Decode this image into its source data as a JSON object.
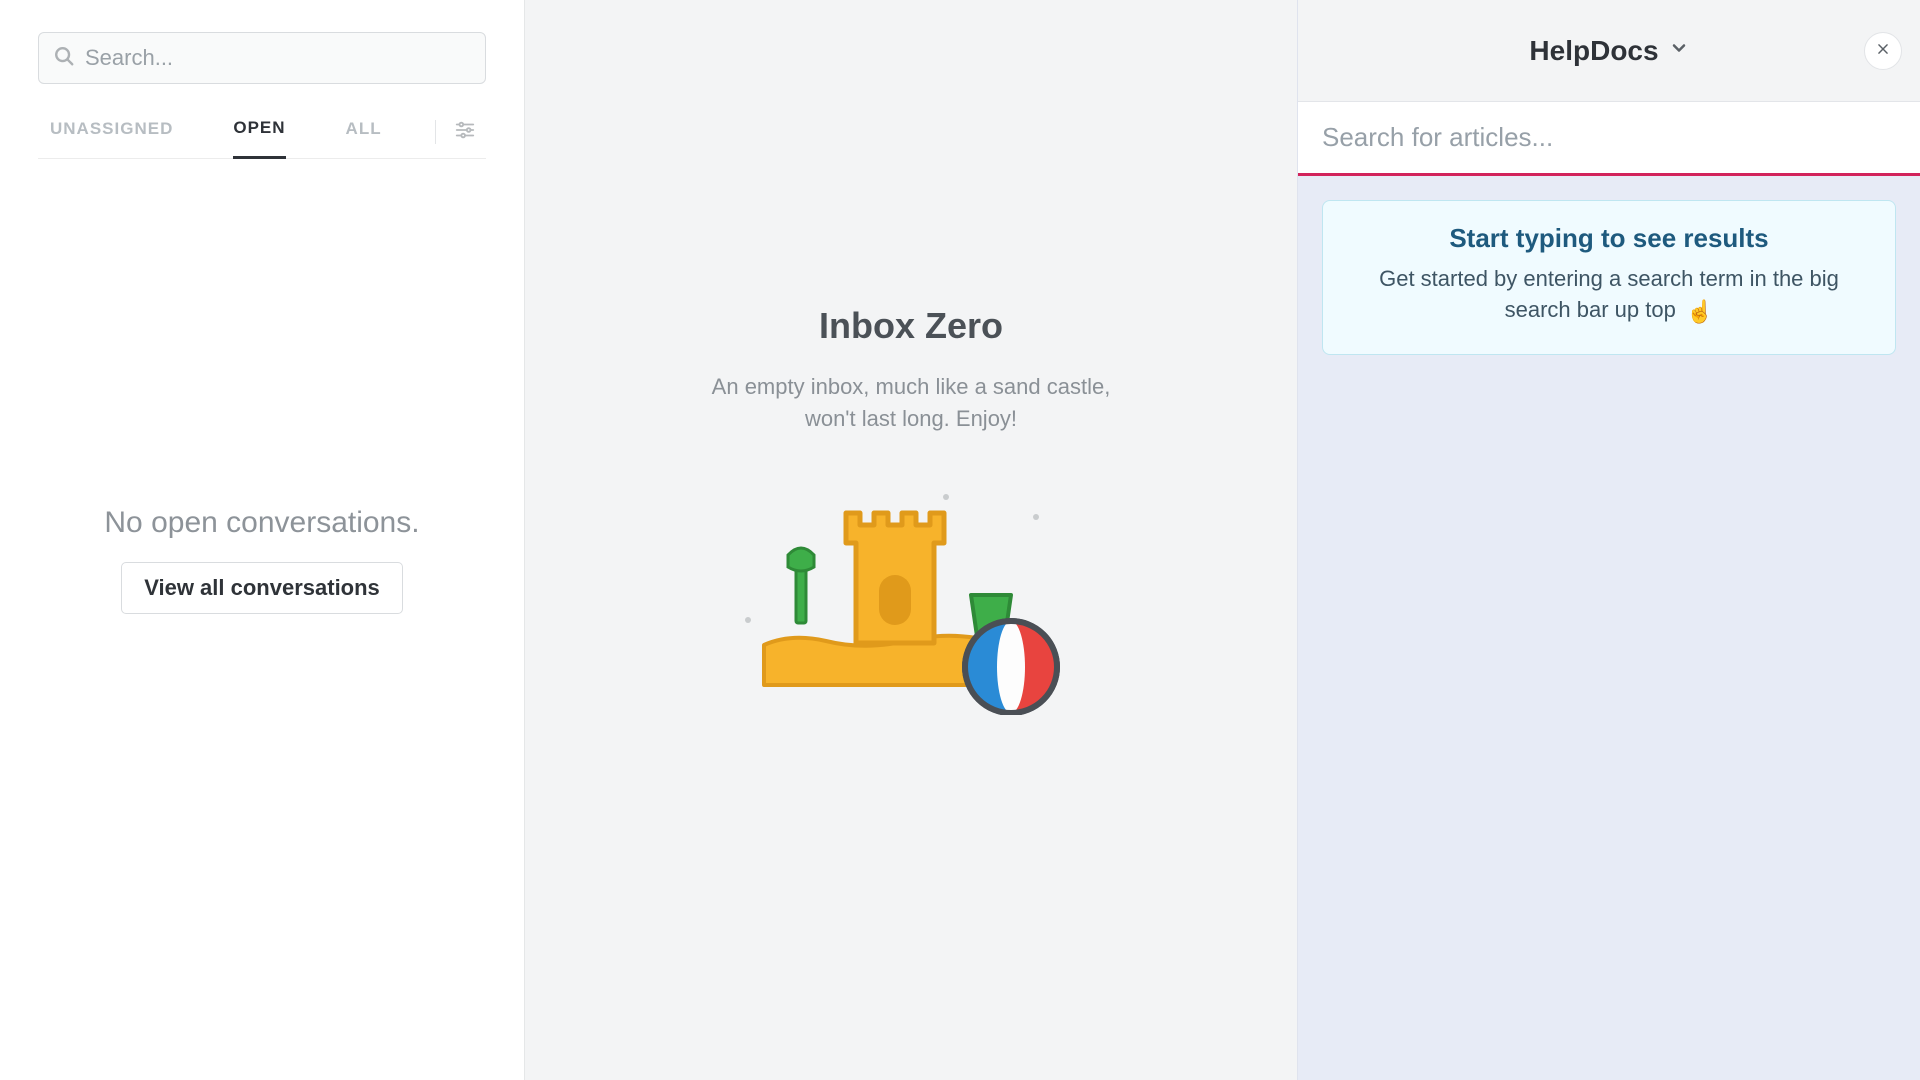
{
  "sidebar": {
    "search_placeholder": "Search...",
    "tabs": {
      "unassigned": "UNASSIGNED",
      "open": "OPEN",
      "all": "ALL"
    },
    "empty_text": "No open conversations.",
    "view_all_label": "View all conversations"
  },
  "main": {
    "title": "Inbox Zero",
    "subtitle_line1": "An empty inbox, much like a sand castle,",
    "subtitle_line2": "won't last long. Enjoy!"
  },
  "help": {
    "title": "HelpDocs",
    "search_placeholder": "Search for articles...",
    "card_title": "Start typing to see results",
    "card_body": "Get started by entering a search term in the big search bar up top"
  }
}
